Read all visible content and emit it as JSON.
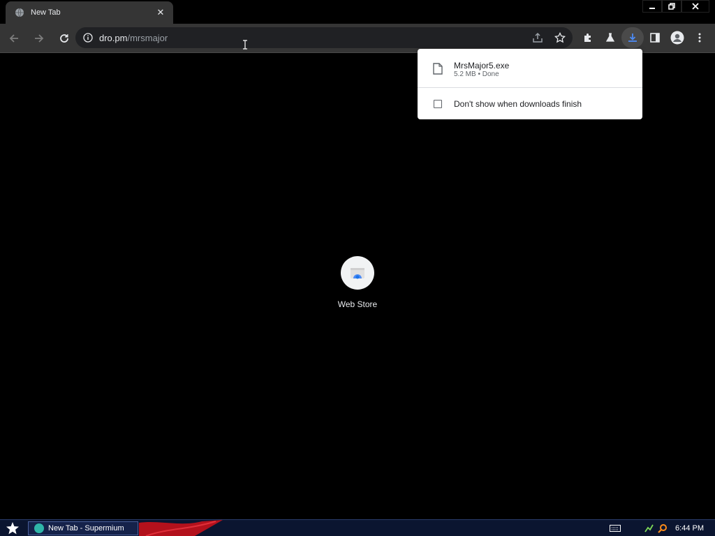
{
  "browser": {
    "tab": {
      "title": "New Tab"
    },
    "omnibox": {
      "host": "dro.pm",
      "path": "/mrsmajor"
    },
    "window_controls": [
      "minimize",
      "restore",
      "close"
    ]
  },
  "downloads_bubble": {
    "item": {
      "filename": "MrsMajor5.exe",
      "status": "5.2 MB • Done"
    },
    "option_label": "Don't show when downloads finish",
    "option_checked": false
  },
  "new_tab_page": {
    "shortcuts": [
      {
        "label": "Web Store"
      }
    ]
  },
  "taskbar": {
    "active_window": "New Tab - Supermium",
    "clock": "6:44 PM"
  },
  "colors": {
    "accent_blue": "#4c8bf5",
    "toolbar": "#353535",
    "taskbar": "#0b1530"
  }
}
